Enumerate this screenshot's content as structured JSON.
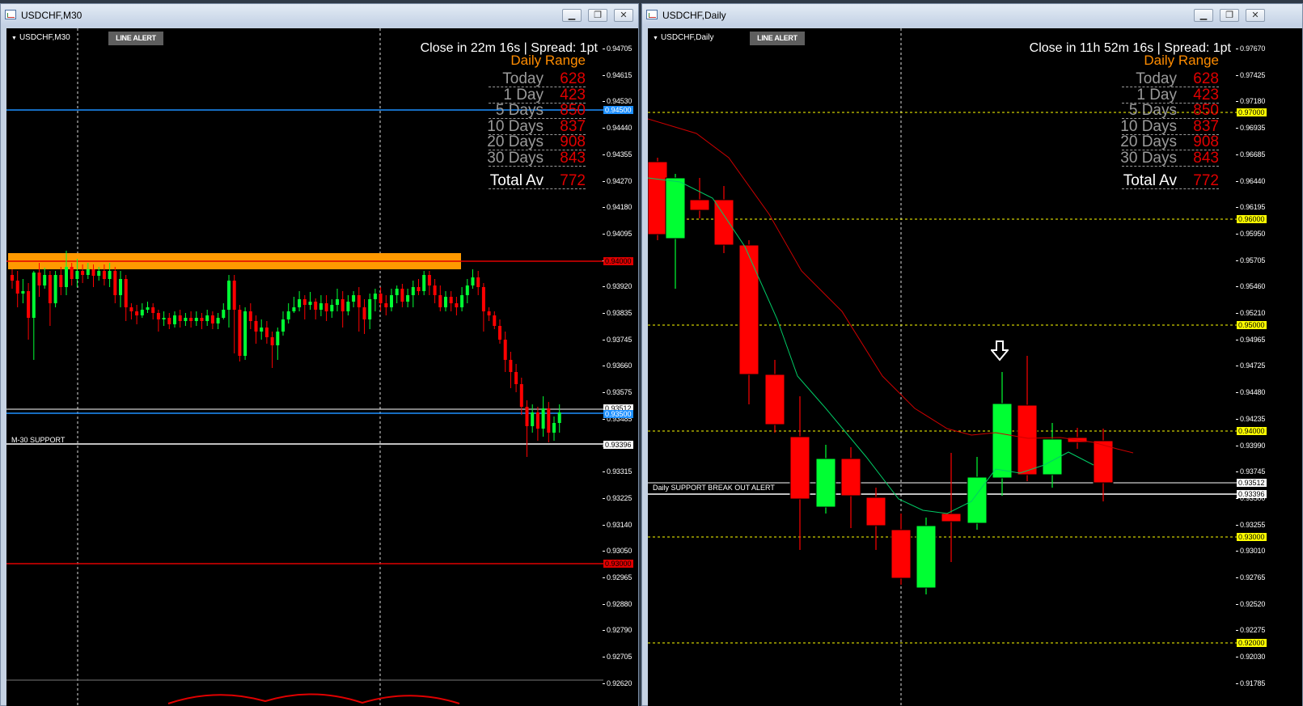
{
  "left": {
    "window_title": "USDCHF,M30",
    "symbol": "USDCHF,M30",
    "line_alert": "LINE ALERT",
    "close_in": "Close in 22m 16s | Spread: 1pt",
    "support_label": "M-30 SUPPORT",
    "price_tags": [
      {
        "text": "0.94500",
        "bg": "#1e90ff",
        "fg": "#ffffff",
        "price": 0.945
      },
      {
        "text": "0.94000",
        "bg": "#e00000",
        "fg": "#000000",
        "price": 0.94
      },
      {
        "text": "0.93512",
        "bg": "#ffffff",
        "fg": "#000000",
        "price": 0.93512
      },
      {
        "text": "0.93500",
        "bg": "#1e90ff",
        "fg": "#ffffff",
        "price": 0.935
      },
      {
        "text": "0.93396",
        "bg": "#ffffff",
        "fg": "#000000",
        "price": 0.93396
      },
      {
        "text": "0.93000",
        "bg": "#e00000",
        "fg": "#000000",
        "price": 0.93
      }
    ],
    "ticks": [
      "0.94705",
      "0.94615",
      "0.94530",
      "0.94440",
      "0.94355",
      "0.94270",
      "0.94180",
      "0.94095",
      "0.94000",
      "0.93920",
      "0.93835",
      "0.93745",
      "0.93660",
      "0.93575",
      "0.93485",
      "0.93396",
      "0.93315",
      "0.93225",
      "0.93140",
      "0.93050",
      "0.92965",
      "0.92880",
      "0.92790",
      "0.92705",
      "0.92620"
    ]
  },
  "right": {
    "window_title": "USDCHF,Daily",
    "symbol": "USDCHF,Daily",
    "line_alert": "LINE ALERT",
    "close_in": "Close in 11h 52m 16s | Spread: 1pt",
    "support_label": "Daily SUPPORT BREAK OUT ALERT",
    "price_tags": [
      {
        "text": "0.97000",
        "bg": "#ffff00",
        "fg": "#000000"
      },
      {
        "text": "0.96000",
        "bg": "#ffff00",
        "fg": "#000000"
      },
      {
        "text": "0.95000",
        "bg": "#ffff00",
        "fg": "#000000"
      },
      {
        "text": "0.94000",
        "bg": "#ffff00",
        "fg": "#000000"
      },
      {
        "text": "0.93512",
        "bg": "#ffffff",
        "fg": "#000000"
      },
      {
        "text": "0.93396",
        "bg": "#ffffff",
        "fg": "#000000"
      },
      {
        "text": "0.93000",
        "bg": "#ffff00",
        "fg": "#000000"
      },
      {
        "text": "0.92000",
        "bg": "#ffff00",
        "fg": "#000000"
      }
    ],
    "ticks": [
      "0.97670",
      "0.97425",
      "0.97180",
      "0.96935",
      "0.96685",
      "0.96440",
      "0.96195",
      "0.95950",
      "0.95705",
      "0.95460",
      "0.95210",
      "0.94965",
      "0.94725",
      "0.94480",
      "0.94235",
      "0.93990",
      "0.93745",
      "0.93500",
      "0.93255",
      "0.93010",
      "0.92765",
      "0.92520",
      "0.92275",
      "0.92030",
      "0.91785"
    ]
  },
  "daily_range": {
    "title": "Daily Range",
    "rows": [
      {
        "label": "Today",
        "value": "628"
      },
      {
        "label": "1 Day",
        "value": "423"
      },
      {
        "label": "5 Days",
        "value": "850"
      },
      {
        "label": "10 Days",
        "value": "837"
      },
      {
        "label": "20 Days",
        "value": "908"
      },
      {
        "label": "30 Days",
        "value": "843"
      }
    ],
    "total_label": "Total Av",
    "total_value": "772"
  },
  "colors": {
    "bull": "#00ff33",
    "bear": "#ff0000",
    "support_zone": "#ff9900",
    "ma_fast": "#00cc66",
    "ma_slow": "#cc0000"
  },
  "icons": {
    "minimize": "minimize-icon",
    "restore": "restore-icon",
    "close": "close-icon",
    "arrow": "down-arrow-icon"
  }
}
